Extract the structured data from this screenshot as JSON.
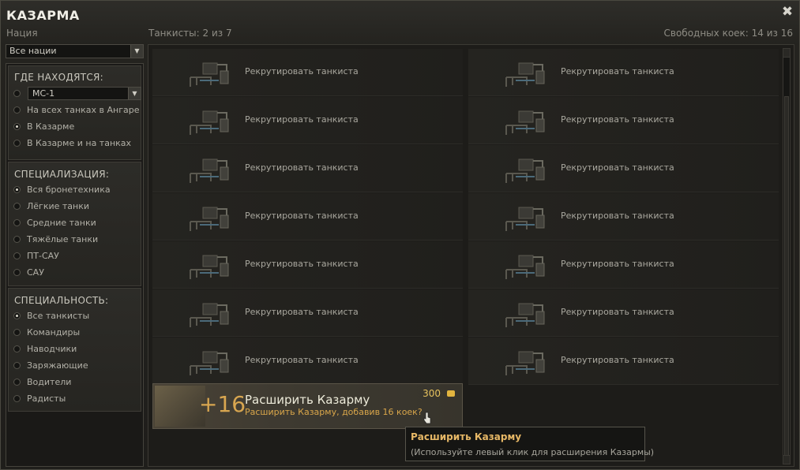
{
  "window": {
    "title": "КАЗАРМА",
    "nation_label": "Нация",
    "tankmen_count": "Танкисты: 2 из 7",
    "free_beds": "Свободных коек: 14 из 16"
  },
  "filters": {
    "nation_select": "Все нации",
    "location": {
      "title": "ГДЕ НАХОДЯТСЯ:",
      "vehicle_value": "МС-1",
      "options": [
        "На всех танках в Ангаре",
        "В Казарме",
        "В Казарме и на танках"
      ],
      "selected": "В Казарме"
    },
    "specialization": {
      "title": "СПЕЦИАЛИЗАЦИЯ:",
      "options": [
        "Вся бронетехника",
        "Лёгкие танки",
        "Средние танки",
        "Тяжёлые танки",
        "ПТ-САУ",
        "САУ"
      ],
      "selected": "Вся бронетехника"
    },
    "role": {
      "title": "СПЕЦИАЛЬНОСТЬ:",
      "options": [
        "Все танкисты",
        "Командиры",
        "Наводчики",
        "Заряжающие",
        "Водители",
        "Радисты"
      ],
      "selected": "Все танкисты"
    }
  },
  "slots": {
    "recruit_label": "Рекрутировать танкиста",
    "count": 14
  },
  "expand": {
    "plus": "+16",
    "title": "Расширить Казарму",
    "subtitle": "Расширить Казарму, добавив 16 коек?",
    "price": "300"
  },
  "tooltip": {
    "title": "Расширить Казарму",
    "body": "(Используйте левый клик для расширения Казармы)"
  },
  "icons": {
    "close": "close-icon",
    "gold": "gold-coin-icon",
    "bunk": "bunk-bed-icon"
  },
  "colors": {
    "accent": "#e7b866",
    "gold": "#e2b43f",
    "orange": "#d9a64a"
  }
}
